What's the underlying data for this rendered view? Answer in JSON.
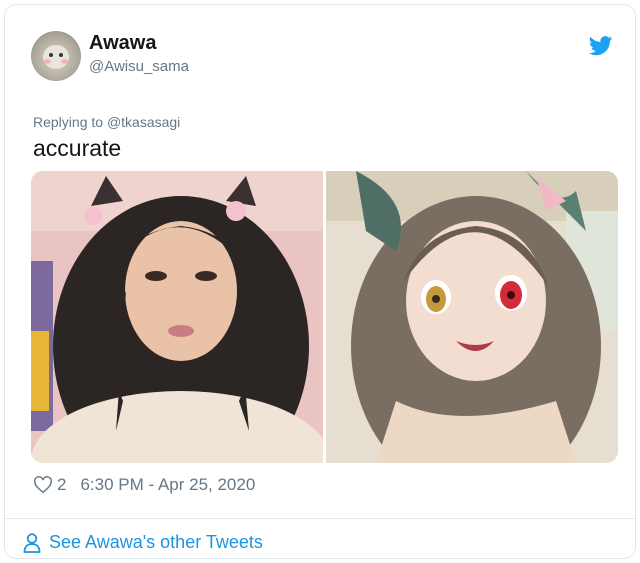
{
  "user": {
    "name": "Awawa",
    "handle": "@Awisu_sama"
  },
  "tweet": {
    "replying_prefix": "Replying to",
    "replying_to": "@tkasasagi",
    "text": "accurate",
    "likes": "2",
    "timestamp": "6:30 PM - Apr 25, 2020"
  },
  "footer": {
    "see_more": "See Awawa's other Tweets"
  },
  "colors": {
    "brand_blue": "#1da1f2",
    "link_blue": "#1b95e0",
    "secondary_text": "#657786",
    "border": "#e1e8ed"
  },
  "icons": {
    "logo": "twitter-bird-icon",
    "like": "heart-outline-icon",
    "profile": "person-outline-icon"
  }
}
